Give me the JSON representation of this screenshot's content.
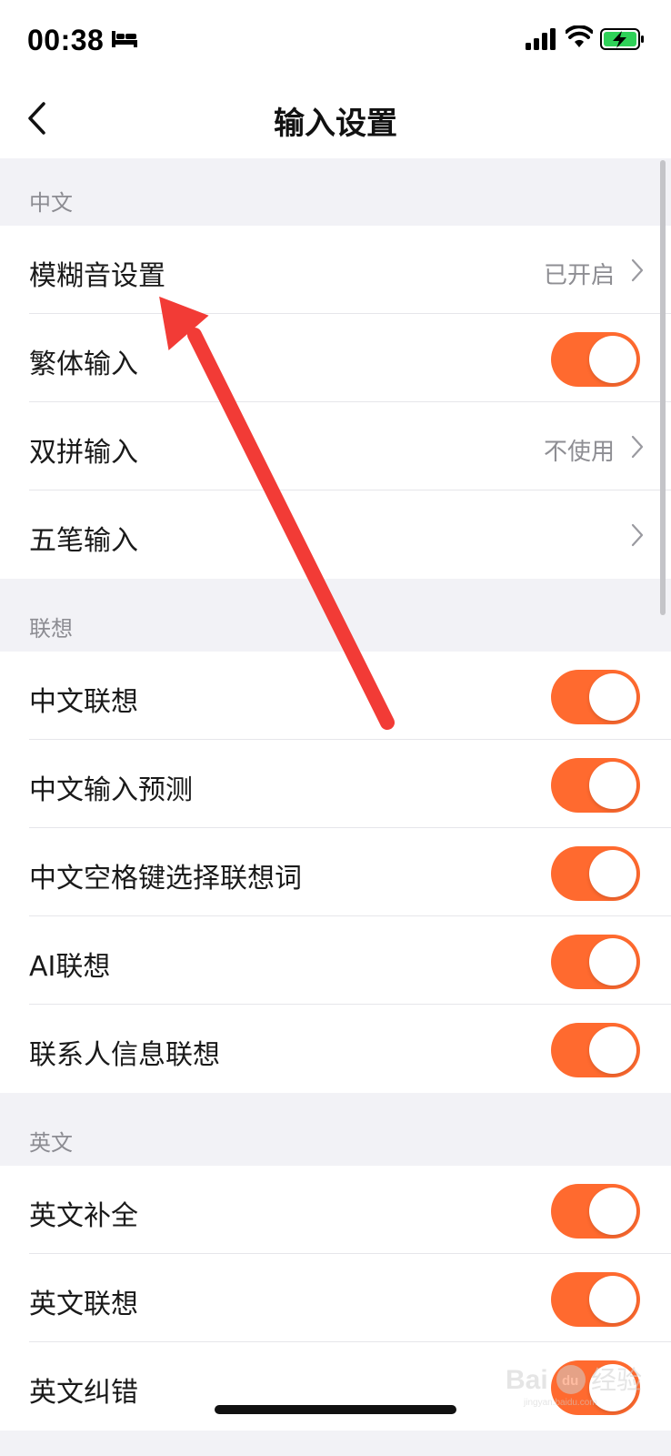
{
  "status_bar": {
    "time": "00:38",
    "icons": [
      "bed-icon",
      "cellular-signal-icon",
      "wifi-icon",
      "battery-charging-icon"
    ]
  },
  "nav": {
    "title": "输入设置",
    "back_icon": "chevron-left-icon"
  },
  "colors": {
    "toggle_on": "#ff6a2f",
    "annotation_arrow": "#f23b36",
    "background_grouped": "#f2f2f6",
    "secondary_text": "#8e8e93"
  },
  "sections": [
    {
      "header": "中文",
      "rows": [
        {
          "label": "模糊音设置",
          "type": "link",
          "value": "已开启"
        },
        {
          "label": "繁体输入",
          "type": "toggle",
          "on": true
        },
        {
          "label": "双拼输入",
          "type": "link",
          "value": "不使用"
        },
        {
          "label": "五笔输入",
          "type": "link",
          "value": ""
        }
      ]
    },
    {
      "header": "联想",
      "rows": [
        {
          "label": "中文联想",
          "type": "toggle",
          "on": true
        },
        {
          "label": "中文输入预测",
          "type": "toggle",
          "on": true
        },
        {
          "label": "中文空格键选择联想词",
          "type": "toggle",
          "on": true
        },
        {
          "label": "AI联想",
          "type": "toggle",
          "on": true
        },
        {
          "label": "联系人信息联想",
          "type": "toggle",
          "on": true
        }
      ]
    },
    {
      "header": "英文",
      "rows": [
        {
          "label": "英文补全",
          "type": "toggle",
          "on": true
        },
        {
          "label": "英文联想",
          "type": "toggle",
          "on": true
        },
        {
          "label": "英文纠错",
          "type": "toggle",
          "on": true
        }
      ]
    }
  ],
  "watermark": {
    "text": "Bai du 经验",
    "subtext": "jingyan.baidu.com"
  }
}
